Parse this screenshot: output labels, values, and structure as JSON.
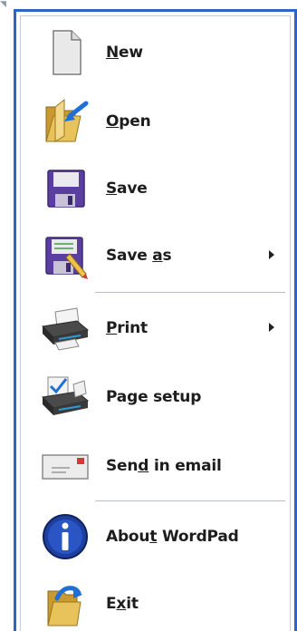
{
  "menu": {
    "items": [
      {
        "id": "new",
        "label_pre": "",
        "mnemonic": "N",
        "label_post": "ew",
        "icon": "new-document-icon",
        "submenu": false
      },
      {
        "id": "open",
        "label_pre": "",
        "mnemonic": "O",
        "label_post": "pen",
        "icon": "open-folder-icon",
        "submenu": false
      },
      {
        "id": "save",
        "label_pre": "",
        "mnemonic": "S",
        "label_post": "ave",
        "icon": "floppy-disk-icon",
        "submenu": false
      },
      {
        "id": "save-as",
        "label_pre": "Save ",
        "mnemonic": "a",
        "label_post": "s",
        "icon": "floppy-disk-pencil-icon",
        "submenu": true
      },
      {
        "id": "print",
        "label_pre": "",
        "mnemonic": "P",
        "label_post": "rint",
        "icon": "printer-icon",
        "submenu": true
      },
      {
        "id": "page-setup",
        "label_pre": "Pa",
        "mnemonic": "g",
        "label_post": "e setup",
        "icon": "printer-check-icon",
        "submenu": false
      },
      {
        "id": "send-email",
        "label_pre": "Sen",
        "mnemonic": "d",
        "label_post": " in email",
        "icon": "envelope-icon",
        "submenu": false
      },
      {
        "id": "about",
        "label_pre": "Abou",
        "mnemonic": "t",
        "label_post": " WordPad",
        "icon": "info-icon",
        "submenu": false
      },
      {
        "id": "exit",
        "label_pre": "E",
        "mnemonic": "x",
        "label_post": "it",
        "icon": "exit-icon",
        "submenu": false
      }
    ]
  },
  "colors": {
    "frame": "#2a66c8",
    "text": "#1d1d1d",
    "separator": "#b9bfc8"
  }
}
